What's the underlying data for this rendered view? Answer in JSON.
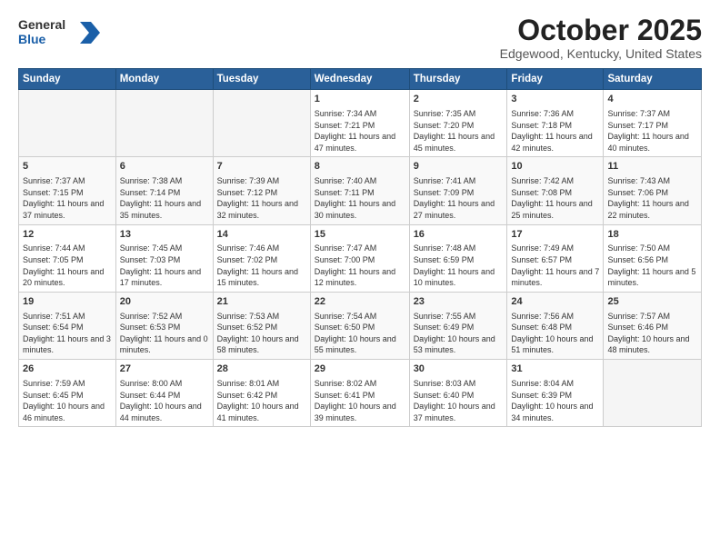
{
  "header": {
    "logo": {
      "general": "General",
      "blue": "Blue"
    },
    "title": "October 2025",
    "location": "Edgewood, Kentucky, United States"
  },
  "weekdays": [
    "Sunday",
    "Monday",
    "Tuesday",
    "Wednesday",
    "Thursday",
    "Friday",
    "Saturday"
  ],
  "weeks": [
    [
      {
        "day": "",
        "info": ""
      },
      {
        "day": "",
        "info": ""
      },
      {
        "day": "",
        "info": ""
      },
      {
        "day": "1",
        "info": "Sunrise: 7:34 AM\nSunset: 7:21 PM\nDaylight: 11 hours\nand 47 minutes."
      },
      {
        "day": "2",
        "info": "Sunrise: 7:35 AM\nSunset: 7:20 PM\nDaylight: 11 hours\nand 45 minutes."
      },
      {
        "day": "3",
        "info": "Sunrise: 7:36 AM\nSunset: 7:18 PM\nDaylight: 11 hours\nand 42 minutes."
      },
      {
        "day": "4",
        "info": "Sunrise: 7:37 AM\nSunset: 7:17 PM\nDaylight: 11 hours\nand 40 minutes."
      }
    ],
    [
      {
        "day": "5",
        "info": "Sunrise: 7:37 AM\nSunset: 7:15 PM\nDaylight: 11 hours\nand 37 minutes."
      },
      {
        "day": "6",
        "info": "Sunrise: 7:38 AM\nSunset: 7:14 PM\nDaylight: 11 hours\nand 35 minutes."
      },
      {
        "day": "7",
        "info": "Sunrise: 7:39 AM\nSunset: 7:12 PM\nDaylight: 11 hours\nand 32 minutes."
      },
      {
        "day": "8",
        "info": "Sunrise: 7:40 AM\nSunset: 7:11 PM\nDaylight: 11 hours\nand 30 minutes."
      },
      {
        "day": "9",
        "info": "Sunrise: 7:41 AM\nSunset: 7:09 PM\nDaylight: 11 hours\nand 27 minutes."
      },
      {
        "day": "10",
        "info": "Sunrise: 7:42 AM\nSunset: 7:08 PM\nDaylight: 11 hours\nand 25 minutes."
      },
      {
        "day": "11",
        "info": "Sunrise: 7:43 AM\nSunset: 7:06 PM\nDaylight: 11 hours\nand 22 minutes."
      }
    ],
    [
      {
        "day": "12",
        "info": "Sunrise: 7:44 AM\nSunset: 7:05 PM\nDaylight: 11 hours\nand 20 minutes."
      },
      {
        "day": "13",
        "info": "Sunrise: 7:45 AM\nSunset: 7:03 PM\nDaylight: 11 hours\nand 17 minutes."
      },
      {
        "day": "14",
        "info": "Sunrise: 7:46 AM\nSunset: 7:02 PM\nDaylight: 11 hours\nand 15 minutes."
      },
      {
        "day": "15",
        "info": "Sunrise: 7:47 AM\nSunset: 7:00 PM\nDaylight: 11 hours\nand 12 minutes."
      },
      {
        "day": "16",
        "info": "Sunrise: 7:48 AM\nSunset: 6:59 PM\nDaylight: 11 hours\nand 10 minutes."
      },
      {
        "day": "17",
        "info": "Sunrise: 7:49 AM\nSunset: 6:57 PM\nDaylight: 11 hours\nand 7 minutes."
      },
      {
        "day": "18",
        "info": "Sunrise: 7:50 AM\nSunset: 6:56 PM\nDaylight: 11 hours\nand 5 minutes."
      }
    ],
    [
      {
        "day": "19",
        "info": "Sunrise: 7:51 AM\nSunset: 6:54 PM\nDaylight: 11 hours\nand 3 minutes."
      },
      {
        "day": "20",
        "info": "Sunrise: 7:52 AM\nSunset: 6:53 PM\nDaylight: 11 hours\nand 0 minutes."
      },
      {
        "day": "21",
        "info": "Sunrise: 7:53 AM\nSunset: 6:52 PM\nDaylight: 10 hours\nand 58 minutes."
      },
      {
        "day": "22",
        "info": "Sunrise: 7:54 AM\nSunset: 6:50 PM\nDaylight: 10 hours\nand 55 minutes."
      },
      {
        "day": "23",
        "info": "Sunrise: 7:55 AM\nSunset: 6:49 PM\nDaylight: 10 hours\nand 53 minutes."
      },
      {
        "day": "24",
        "info": "Sunrise: 7:56 AM\nSunset: 6:48 PM\nDaylight: 10 hours\nand 51 minutes."
      },
      {
        "day": "25",
        "info": "Sunrise: 7:57 AM\nSunset: 6:46 PM\nDaylight: 10 hours\nand 48 minutes."
      }
    ],
    [
      {
        "day": "26",
        "info": "Sunrise: 7:59 AM\nSunset: 6:45 PM\nDaylight: 10 hours\nand 46 minutes."
      },
      {
        "day": "27",
        "info": "Sunrise: 8:00 AM\nSunset: 6:44 PM\nDaylight: 10 hours\nand 44 minutes."
      },
      {
        "day": "28",
        "info": "Sunrise: 8:01 AM\nSunset: 6:42 PM\nDaylight: 10 hours\nand 41 minutes."
      },
      {
        "day": "29",
        "info": "Sunrise: 8:02 AM\nSunset: 6:41 PM\nDaylight: 10 hours\nand 39 minutes."
      },
      {
        "day": "30",
        "info": "Sunrise: 8:03 AM\nSunset: 6:40 PM\nDaylight: 10 hours\nand 37 minutes."
      },
      {
        "day": "31",
        "info": "Sunrise: 8:04 AM\nSunset: 6:39 PM\nDaylight: 10 hours\nand 34 minutes."
      },
      {
        "day": "",
        "info": ""
      }
    ]
  ]
}
